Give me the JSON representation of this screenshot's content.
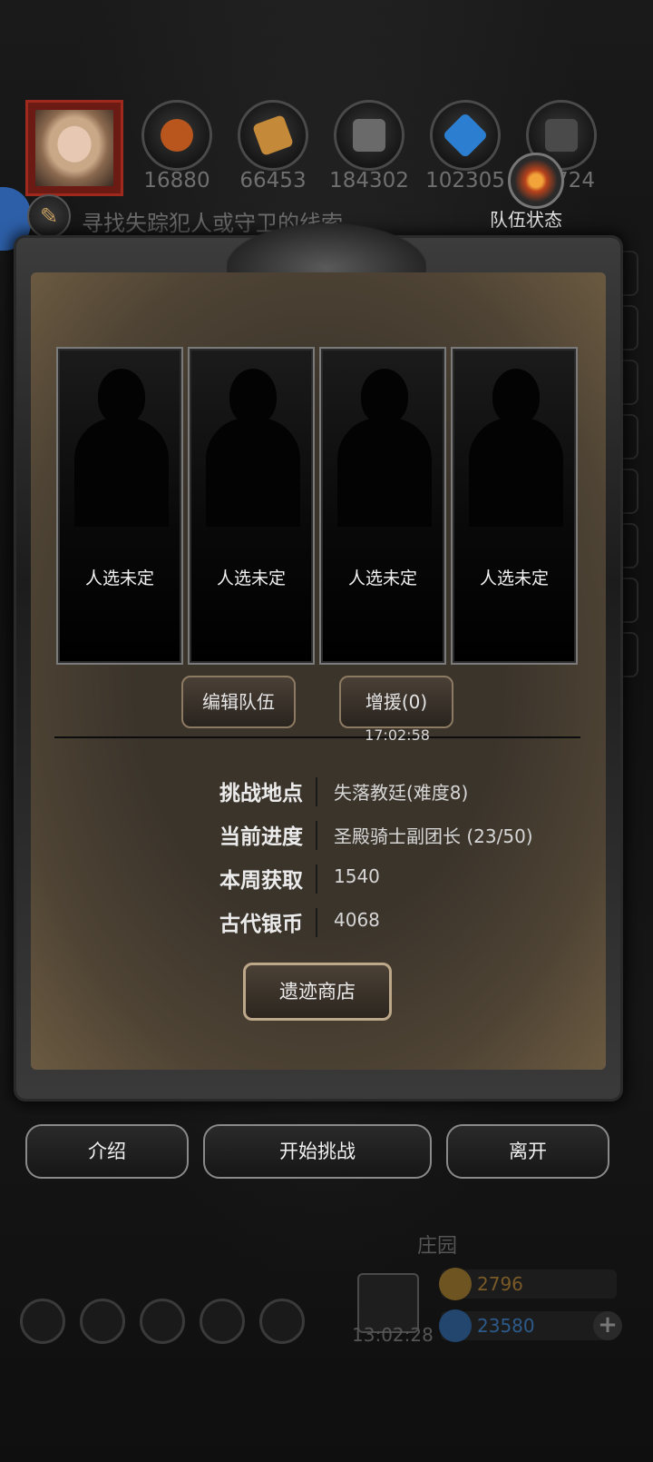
{
  "resources": [
    {
      "name": "food",
      "value": "16880",
      "color": "#b8561e"
    },
    {
      "name": "wood",
      "value": "66453",
      "color": "#c48a3a"
    },
    {
      "name": "iron",
      "value": "184302",
      "color": "#6a6a6a"
    },
    {
      "name": "crystal",
      "value": "102305",
      "color": "#2c7fd0"
    },
    {
      "name": "stone",
      "value": "724",
      "color": "#4a4a4a"
    }
  ],
  "quest": {
    "text": "寻找失踪犯人或守卫的线索"
  },
  "team_status": {
    "label": "队伍状态"
  },
  "slots": [
    {
      "label": "人选未定"
    },
    {
      "label": "人选未定"
    },
    {
      "label": "人选未定"
    },
    {
      "label": "人选未定"
    }
  ],
  "buttons": {
    "edit_team": "编辑队伍",
    "reinforce": "增援(0)",
    "reinforce_timer": "17:02:58",
    "shop": "遗迹商店",
    "intro": "介绍",
    "start": "开始挑战",
    "leave": "离开"
  },
  "info": [
    {
      "key": "挑战地点",
      "value": "失落教廷(难度8)"
    },
    {
      "key": "当前进度",
      "value": "圣殿骑士副团长 (23/50)"
    },
    {
      "key": "本周获取",
      "value": "1540"
    },
    {
      "key": "古代银币",
      "value": "4068"
    }
  ],
  "hud": {
    "manor_label": "庄园",
    "gift_timer": "13:02:28",
    "gold": "2796",
    "gems": "23580"
  }
}
